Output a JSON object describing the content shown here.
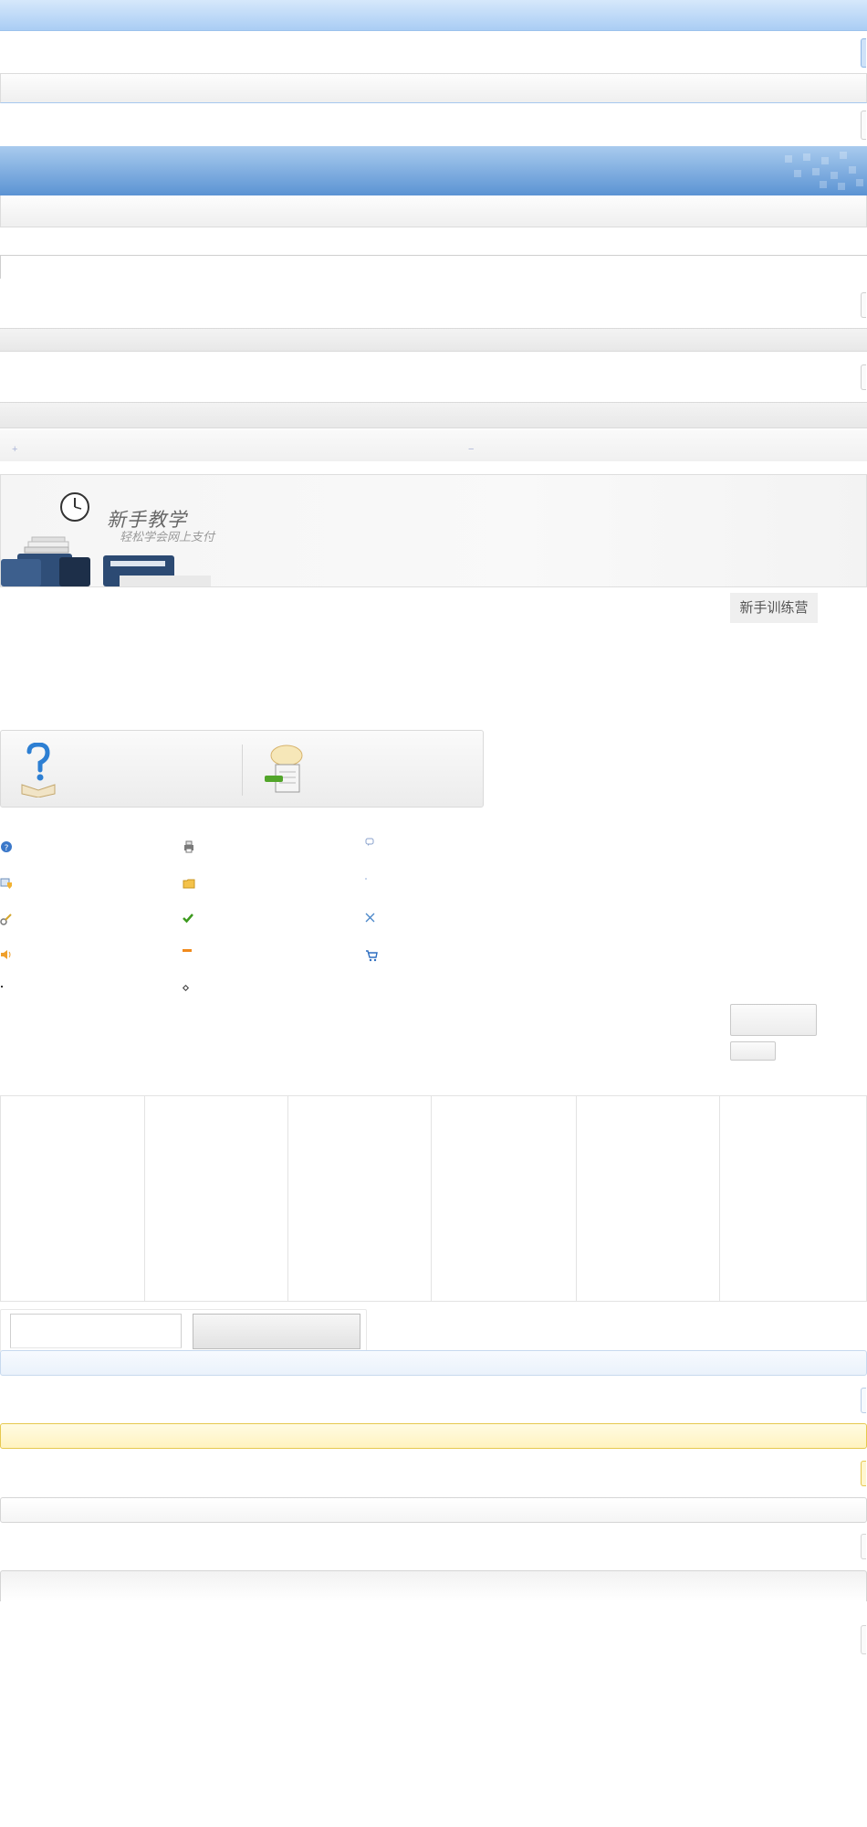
{
  "tutorial": {
    "title": "新手教学",
    "subtitle": "轻松学会网上支付"
  },
  "training_camp": {
    "label": "新手训练营"
  },
  "help_panel": {
    "left_icon": "question-book-icon",
    "right_icon": "speech-document-icon"
  },
  "icon_grid": [
    [
      "help-circle-icon",
      "printer-icon",
      "chat-bubble-icon"
    ],
    [
      "shield-card-icon",
      "folder-icon",
      "dot-icon"
    ],
    [
      "key-wrench-icon",
      "checkmark-icon",
      "cross-icon"
    ],
    [
      "speaker-icon",
      "minus-bar-icon",
      "cart-icon"
    ],
    [
      "bullet-icon",
      "diamond-bullet-icon",
      ""
    ]
  ],
  "colors": {
    "blue_header": "#7aaee0",
    "yellow_notice": "#fff3bf",
    "check_green": "#3c9a1e",
    "minus_orange": "#f08a1c"
  }
}
